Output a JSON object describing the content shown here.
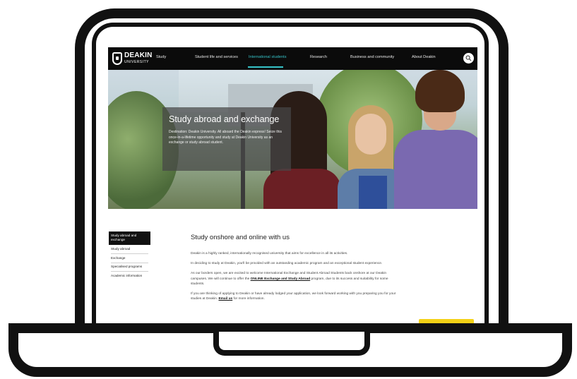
{
  "logo": {
    "line1": "DEAKIN",
    "line2": "UNIVERSITY"
  },
  "nav": {
    "items": [
      "Study",
      "Student life and services",
      "International students",
      "Research",
      "Business and community",
      "About Deakin"
    ],
    "active": "International students"
  },
  "hero": {
    "title": "Study abroad and exchange",
    "text": "Destination: Deakin University. All aboard the Deakin express! Seize this once-in-a-lifetime opportunity and study at Deakin University as an exchange or study abroad student."
  },
  "sidenav": {
    "items": [
      "Study abroad and exchange",
      "Study abroad",
      "Exchange",
      "Specialised programs",
      "Academic information"
    ]
  },
  "content": {
    "heading": "Study onshore and online with us",
    "p1": "Deakin is a highly ranked, internationally recognised university that aims for excellence in all its activities.",
    "p2": "In deciding to study at Deakin, you'll be provided with an outstanding academic program and an exceptional student experience.",
    "p3_a": "As our borders open, we are excited to welcome International Exchange and Student Abroad Students back onshore at our Deakin campuses. We will continue to offer the ",
    "p3_link": "ONLINE Exchange and Study Abroad",
    "p3_b": " program, due to its success and suitability for some students.",
    "p4_a": "If you are thinking of applying to Deakin or have already lodged your application, we look forward working with you preparing you for your studies at Deakin. ",
    "p4_link": "Email us",
    "p4_b": " for more information."
  },
  "colors": {
    "nav_bg": "#0b0b0b",
    "accent": "#36c3c8",
    "chat_button": "#f3d117"
  }
}
